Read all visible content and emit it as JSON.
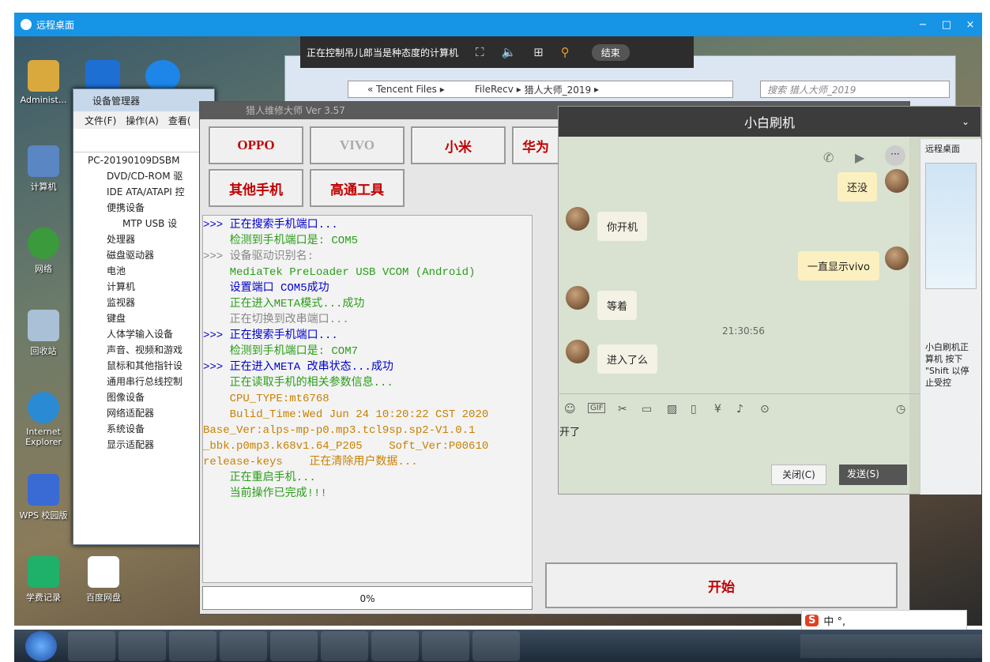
{
  "remote": {
    "title": "远程桌面",
    "min": "−",
    "max": "□",
    "close": "×"
  },
  "controlbar": {
    "status": "正在控制吊儿郎当是种态度的计算机",
    "end": "结束"
  },
  "desktop": {
    "icons": [
      "Administ...",
      "计算机",
      "网络",
      "回收站",
      "Internet Explorer",
      "WPS 校园版",
      "学费记录",
      "百度网盘"
    ]
  },
  "explorer": {
    "path": [
      "«",
      "Tencent Files",
      "▸",
      "FileRecv",
      "▸",
      "猎人大师_2019",
      "▸"
    ],
    "search": "搜索 猎人大师_2019"
  },
  "devmgr": {
    "title": "设备管理器",
    "menu": [
      "文件(F)",
      "操作(A)",
      "查看("
    ],
    "root": "PC-20190109DSBM",
    "items": [
      "DVD/CD-ROM 驱",
      "IDE ATA/ATAPI 控",
      "便携设备",
      "MTP USB 设",
      "处理器",
      "磁盘驱动器",
      "电池",
      "计算机",
      "监视器",
      "键盘",
      "人体学输入设备",
      "声音、视频和游戏",
      "鼠标和其他指针设",
      "通用串行总线控制",
      "图像设备",
      "网络适配器",
      "系统设备",
      "显示适配器"
    ]
  },
  "tool": {
    "title": "猎人维修大师 Ver 3.57",
    "buttons": [
      "OPPO",
      "VIVO",
      "小米",
      "华为",
      "其他手机",
      "高通工具"
    ],
    "log": [
      {
        "t": ">>> 正在搜索手机端口...",
        "c": "blue"
      },
      {
        "t": "    检测到手机端口是: COM5",
        "c": "green"
      },
      {
        "t": ">>> 设备驱动识别名:",
        "c": "gray"
      },
      {
        "t": "    MediaTek PreLoader USB VCOM (Android)",
        "c": "green"
      },
      {
        "t": "    设置端口 COM5成功",
        "c": "blue"
      },
      {
        "t": "    正在进入META模式...成功",
        "c": "green"
      },
      {
        "t": "    正在切换到改串端口...",
        "c": "gray"
      },
      {
        "t": ">>> 正在搜索手机端口...",
        "c": "blue"
      },
      {
        "t": "    检测到手机端口是: COM7",
        "c": "green"
      },
      {
        "t": ">>> 正在进入META 改串状态...成功",
        "c": "blue"
      },
      {
        "t": "    正在读取手机的相关参数信息...",
        "c": "green"
      },
      {
        "t": "    CPU_TYPE:mt6768",
        "c": "orange"
      },
      {
        "t": "    Bulid_Time:Wed Jun 24 10:20:22 CST 2020",
        "c": "orange"
      },
      {
        "t": "Base_Ver:alps-mp-p0.mp3.tcl9sp.sp2-V1.0.1",
        "c": "orange"
      },
      {
        "t": "_bbk.p0mp3.k68v1.64_P205    Soft_Ver:P00610",
        "c": "orange"
      },
      {
        "t": "release-keys    正在清除用户数据...",
        "c": "orange"
      },
      {
        "t": "    正在重启手机...",
        "c": "green"
      },
      {
        "t": "    当前操作已完成!!!",
        "c": "green"
      }
    ],
    "progress": "0%",
    "start": "开始"
  },
  "chat": {
    "title": "小白刷机",
    "messages": [
      "还没",
      "你开机",
      "一直显示vivo",
      "等着",
      "进入了么"
    ],
    "time": "21:30:56",
    "input": "开了",
    "close": "关闭(C)",
    "send": "发送(S)",
    "side_title": "远程桌面",
    "side_text": "小白刷机正 算机 按下 \"Shift 以停止受控"
  },
  "ime": {
    "text": "中 °,"
  }
}
